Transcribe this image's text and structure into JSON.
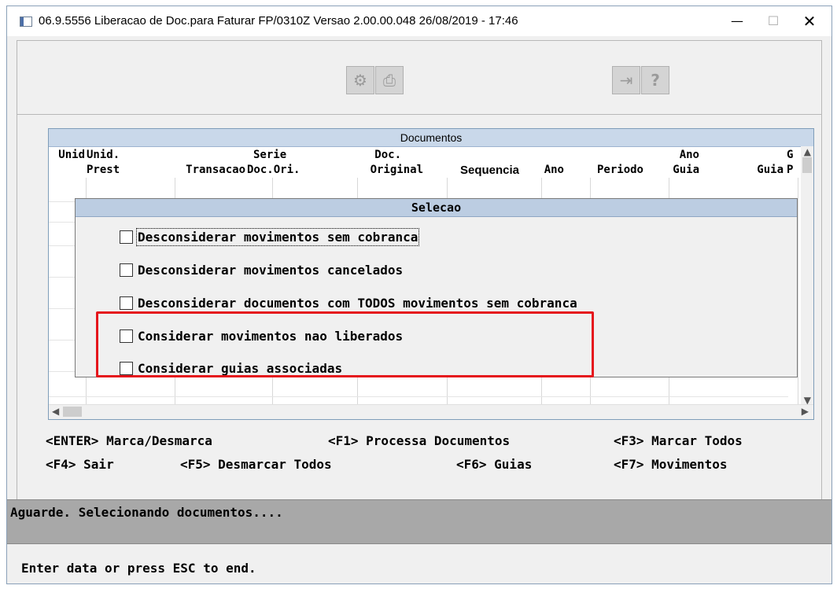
{
  "window": {
    "title": "06.9.5556  Liberacao de Doc.para Faturar FP/0310Z Versao 2.00.00.048 26/08/2019 - 17:46",
    "minimize": "—",
    "maximize": "☐",
    "close": "✕"
  },
  "toolbar": {
    "buttons": [
      {
        "icon": "gears-icon",
        "glyph": "⚙"
      },
      {
        "icon": "printer-icon",
        "glyph": "⎙"
      },
      {
        "icon": "exit-icon",
        "glyph": "⇥"
      },
      {
        "icon": "help-icon",
        "glyph": "?"
      }
    ]
  },
  "grid": {
    "title": "Documentos",
    "columns": [
      {
        "line1": "",
        "line2": "Unid"
      },
      {
        "line1": "Unid.",
        "line2": "Prest"
      },
      {
        "line1": "",
        "line2": "Transacao"
      },
      {
        "line1": "Serie",
        "line2": "Doc.Ori."
      },
      {
        "line1": "Doc.",
        "line2": "Original"
      },
      {
        "line1": "",
        "line2": "Sequencia"
      },
      {
        "line1": "",
        "line2": "Ano"
      },
      {
        "line1": "",
        "line2": "Periodo"
      },
      {
        "line1": "Ano",
        "line2": "Guia"
      },
      {
        "line1": "",
        "line2": "Guia"
      },
      {
        "line1": "G",
        "line2": "P"
      }
    ]
  },
  "selection_dialog": {
    "title": "Selecao",
    "options": [
      {
        "label": "Desconsiderar movimentos sem cobranca",
        "checked": false
      },
      {
        "label": "Desconsiderar movimentos cancelados",
        "checked": false
      },
      {
        "label": "Desconsiderar documentos com TODOS movimentos sem cobranca",
        "checked": false
      },
      {
        "label": "Considerar movimentos nao liberados",
        "checked": false
      },
      {
        "label": "Considerar guias associadas",
        "checked": false
      }
    ]
  },
  "key_hints": {
    "row1": [
      "<ENTER> Marca/Desmarca",
      "<F1> Processa Documentos",
      "<F3> Marcar Todos"
    ],
    "row2": [
      "<F4> Sair",
      "<F5> Desmarcar Todos",
      "<F6> Guias",
      "<F7> Movimentos"
    ]
  },
  "status": {
    "message": "Aguarde. Selecionando documentos....",
    "prompt": "Enter data or press ESC to end."
  },
  "colors": {
    "highlight_border": "#e5151c",
    "grid_header": "#c9d8ea",
    "status_bar": "#a8a8a8"
  }
}
